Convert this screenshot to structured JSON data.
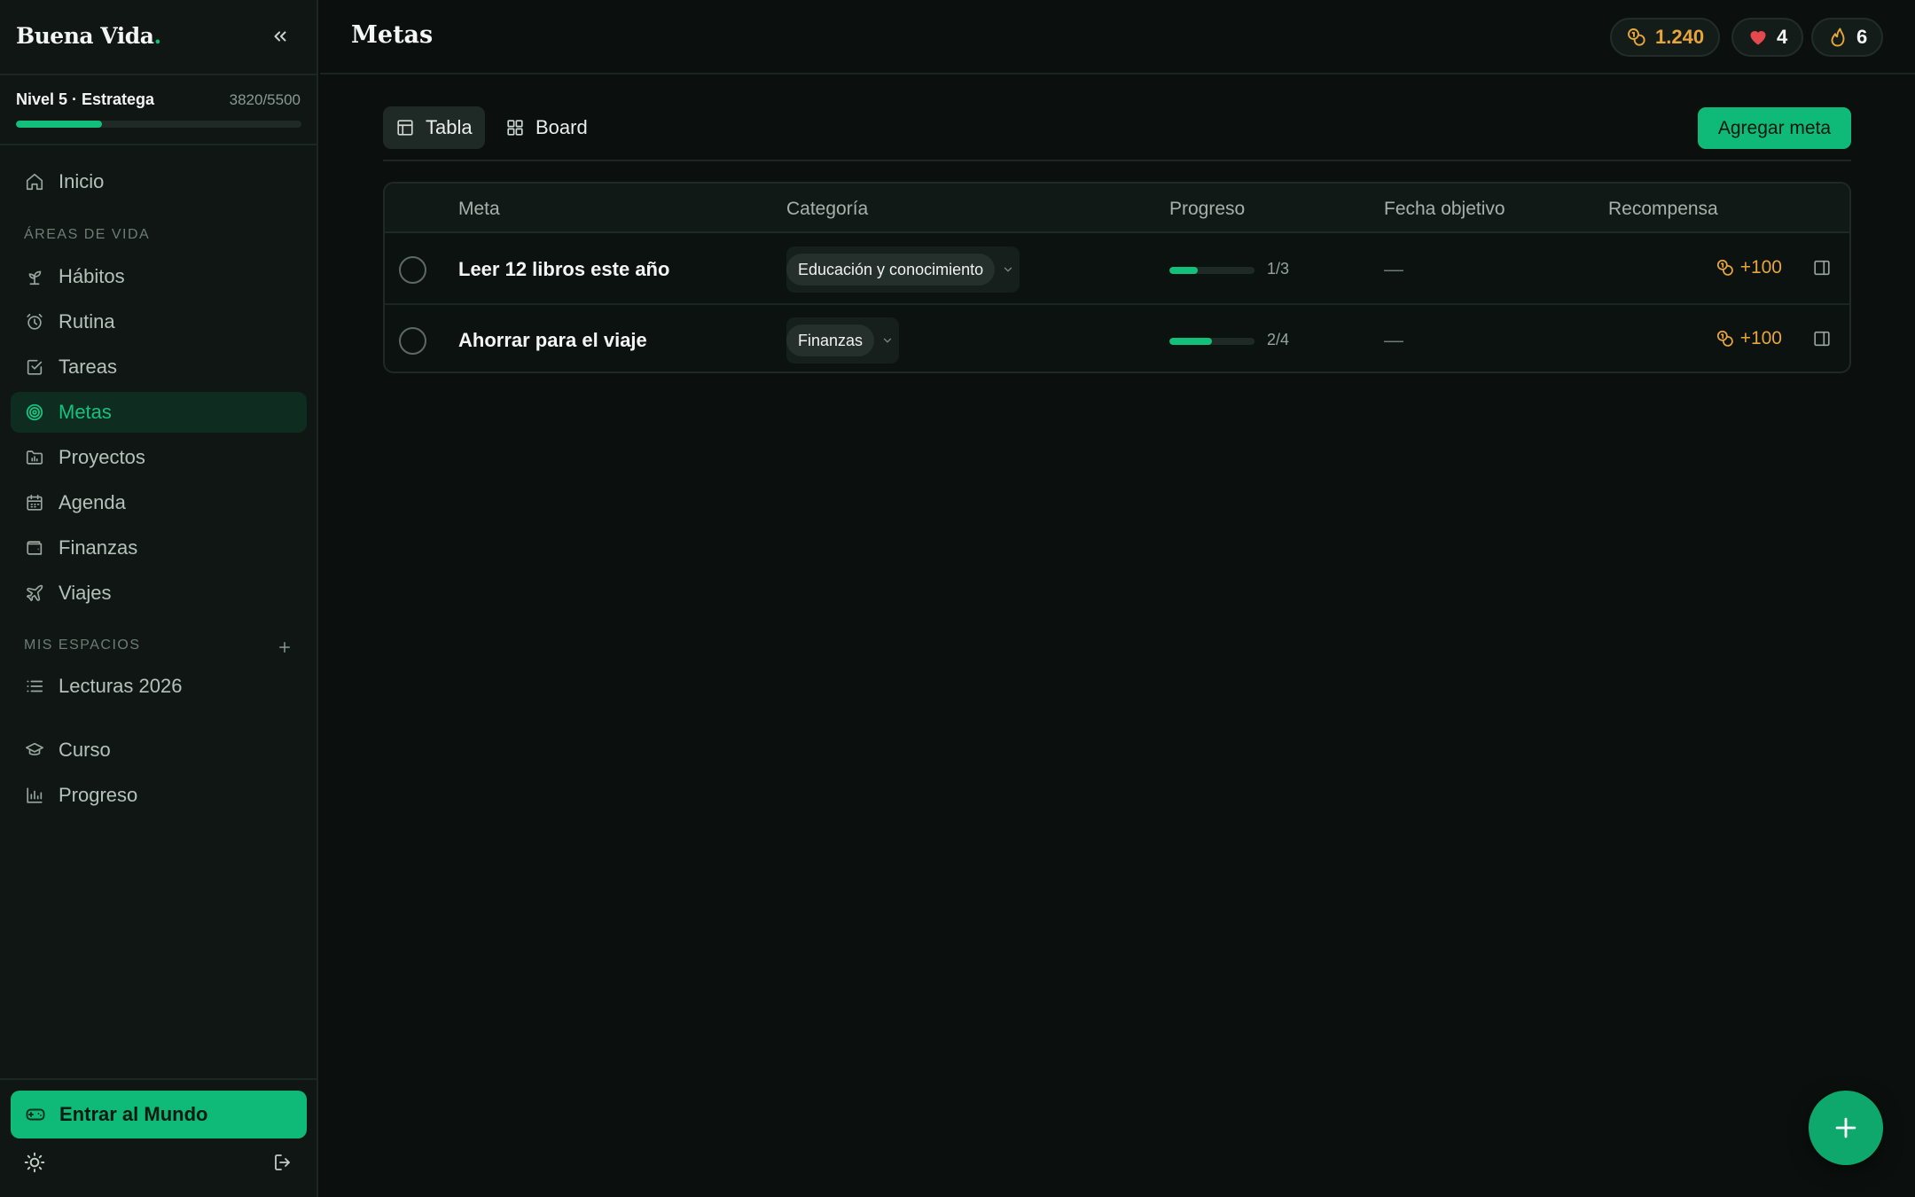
{
  "app": {
    "brand_name": "Buena Vida",
    "brand_dot": ".",
    "accent_color": "#12c07c"
  },
  "level": {
    "label": "Nivel 5 · Estratega",
    "xp_text": "3820/5500",
    "progress_fraction": 0.3
  },
  "sidebar": {
    "home": "Inicio",
    "areas_label": "ÁREAS DE VIDA",
    "areas": [
      {
        "label": "Hábitos",
        "icon": "sprout-icon"
      },
      {
        "label": "Rutina",
        "icon": "alarm-clock-icon"
      },
      {
        "label": "Tareas",
        "icon": "checkbox-icon"
      },
      {
        "label": "Metas",
        "icon": "target-icon",
        "active": true
      },
      {
        "label": "Proyectos",
        "icon": "folder-chart-icon"
      },
      {
        "label": "Agenda",
        "icon": "calendar-icon"
      },
      {
        "label": "Finanzas",
        "icon": "wallet-icon"
      },
      {
        "label": "Viajes",
        "icon": "plane-icon"
      }
    ],
    "spaces_label": "MIS ESPACIOS",
    "spaces": [
      {
        "label": "Lecturas 2026",
        "icon": "list-icon"
      }
    ],
    "extra": [
      {
        "label": "Curso",
        "icon": "graduation-cap-icon"
      },
      {
        "label": "Progreso",
        "icon": "bar-chart-icon"
      }
    ],
    "enter_world": "Entrar al Mundo"
  },
  "header": {
    "title": "Metas",
    "coins": "1.240",
    "hearts": "4",
    "streak": "6",
    "coin_color": "#e7a63b",
    "heart_color": "#e5484d"
  },
  "toolbar": {
    "tabs": [
      {
        "label": "Tabla",
        "active": true
      },
      {
        "label": "Board",
        "active": false
      }
    ],
    "add_goal": "Agregar meta"
  },
  "table": {
    "columns": [
      "Meta",
      "Categoría",
      "Progreso",
      "Fecha objetivo",
      "Recompensa"
    ],
    "rows": [
      {
        "name": "Leer 12 libros este año",
        "category": "Educación y conocimiento",
        "progress_text": "1/3",
        "progress": 0.333,
        "date": "—",
        "reward": "+100"
      },
      {
        "name": "Ahorrar para el viaje",
        "category": "Finanzas",
        "progress_text": "2/4",
        "progress": 0.5,
        "date": "—",
        "reward": "+100"
      }
    ]
  }
}
